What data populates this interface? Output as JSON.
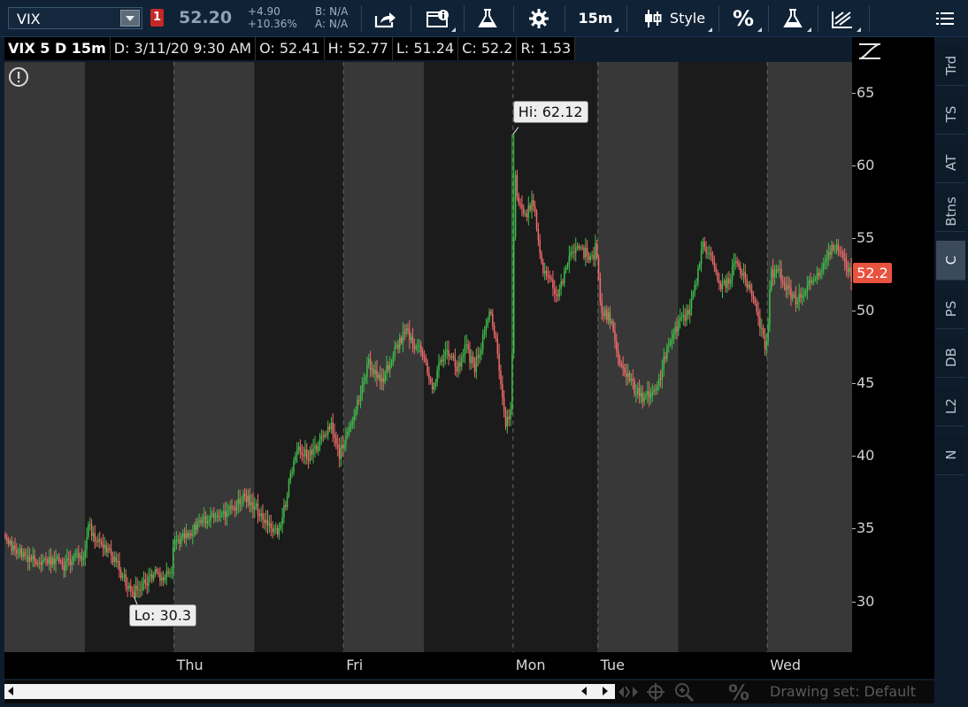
{
  "toolbar": {
    "symbol": "VIX",
    "alert_badge": "1",
    "last_price": "52.20",
    "change_abs": "+4.90",
    "change_pct": "+10.36%",
    "bid": "B: N/A",
    "ask": "A: N/A",
    "timeframe_label": "15m",
    "style_label": "Style",
    "percent_label": "%"
  },
  "info_bar": {
    "title": "VIX 5 D 15m",
    "date": "D: 3/11/20 9:30 AM",
    "open": "O: 52.41",
    "high": "H: 52.77",
    "low": "L: 51.24",
    "close": "C: 52.2",
    "range": "R: 1.53"
  },
  "side_tabs": [
    "Trd",
    "TS",
    "AT",
    "Btns",
    "C",
    "PS",
    "DB",
    "L2",
    "N"
  ],
  "active_side_tab": "C",
  "drawing_set": "Drawing set: Default",
  "colors": {
    "up": "#3fbf4a",
    "down": "#f26b6b",
    "session_light": "#383838",
    "session_dark": "#1b1b1b",
    "last_price_box": "#e8533f"
  },
  "chart_data": {
    "type": "candlestick",
    "symbol": "VIX",
    "ylim": [
      26.5,
      67.1
    ],
    "yticks": [
      30,
      35,
      40,
      45,
      50,
      55,
      60,
      65
    ],
    "xlim": [
      0,
      1
    ],
    "day_labels": [
      {
        "label": "Thu",
        "x": 0.2
      },
      {
        "label": "Fri",
        "x": 0.4
      },
      {
        "label": "Mon",
        "x": 0.6
      },
      {
        "label": "Tue",
        "x": 0.7
      },
      {
        "label": "Wed",
        "x": 0.9
      }
    ],
    "annotations": {
      "high": {
        "label": "Hi: 62.12",
        "value": 62.12,
        "x": 0.6
      },
      "low": {
        "label": "Lo: 30.3",
        "value": 30.3,
        "x": 0.153
      }
    },
    "last_value": "52.2",
    "path": [
      [
        0.0,
        34.6
      ],
      [
        0.01,
        33.8
      ],
      [
        0.02,
        33.2
      ],
      [
        0.035,
        32.8
      ],
      [
        0.05,
        32.7
      ],
      [
        0.06,
        32.9
      ],
      [
        0.07,
        32.3
      ],
      [
        0.08,
        32.9
      ],
      [
        0.095,
        33.2
      ],
      [
        0.1,
        35.3
      ],
      [
        0.11,
        34.2
      ],
      [
        0.125,
        33.5
      ],
      [
        0.135,
        32.4
      ],
      [
        0.145,
        31.1
      ],
      [
        0.153,
        30.5
      ],
      [
        0.165,
        31.3
      ],
      [
        0.18,
        31.9
      ],
      [
        0.19,
        31.6
      ],
      [
        0.199,
        31.9
      ],
      [
        0.2,
        33.8
      ],
      [
        0.215,
        34.6
      ],
      [
        0.23,
        35.3
      ],
      [
        0.25,
        36.0
      ],
      [
        0.27,
        36.2
      ],
      [
        0.285,
        37.2
      ],
      [
        0.295,
        36.5
      ],
      [
        0.305,
        36.0
      ],
      [
        0.315,
        35.0
      ],
      [
        0.325,
        34.8
      ],
      [
        0.335,
        37.5
      ],
      [
        0.345,
        40.5
      ],
      [
        0.36,
        40.0
      ],
      [
        0.375,
        41.0
      ],
      [
        0.385,
        42.3
      ],
      [
        0.395,
        40.0
      ],
      [
        0.405,
        41.5
      ],
      [
        0.415,
        43.0
      ],
      [
        0.43,
        46.5
      ],
      [
        0.445,
        45.0
      ],
      [
        0.46,
        47.0
      ],
      [
        0.475,
        48.5
      ],
      [
        0.485,
        47.5
      ],
      [
        0.495,
        47.0
      ],
      [
        0.505,
        44.5
      ],
      [
        0.515,
        46.5
      ],
      [
        0.525,
        47.0
      ],
      [
        0.535,
        46.0
      ],
      [
        0.545,
        47.5
      ],
      [
        0.555,
        46.0
      ],
      [
        0.565,
        48.0
      ],
      [
        0.575,
        50.0
      ],
      [
        0.585,
        46.0
      ],
      [
        0.592,
        42.0
      ],
      [
        0.599,
        43.0
      ],
      [
        0.603,
        59.5
      ],
      [
        0.607,
        57.5
      ],
      [
        0.615,
        56.5
      ],
      [
        0.625,
        57.5
      ],
      [
        0.635,
        53.0
      ],
      [
        0.645,
        52.0
      ],
      [
        0.655,
        51.0
      ],
      [
        0.665,
        53.5
      ],
      [
        0.675,
        54.5
      ],
      [
        0.685,
        54.0
      ],
      [
        0.695,
        53.5
      ],
      [
        0.699,
        54.5
      ],
      [
        0.705,
        50.0
      ],
      [
        0.715,
        49.5
      ],
      [
        0.725,
        47.0
      ],
      [
        0.735,
        45.5
      ],
      [
        0.745,
        44.5
      ],
      [
        0.755,
        44.0
      ],
      [
        0.765,
        44.5
      ],
      [
        0.775,
        45.5
      ],
      [
        0.785,
        48.0
      ],
      [
        0.795,
        49.0
      ],
      [
        0.805,
        49.5
      ],
      [
        0.815,
        51.5
      ],
      [
        0.825,
        54.5
      ],
      [
        0.835,
        54.0
      ],
      [
        0.845,
        51.5
      ],
      [
        0.855,
        52.0
      ],
      [
        0.865,
        53.5
      ],
      [
        0.875,
        52.0
      ],
      [
        0.885,
        50.5
      ],
      [
        0.895,
        48.5
      ],
      [
        0.899,
        46.5
      ],
      [
        0.905,
        52.5
      ],
      [
        0.915,
        52.5
      ],
      [
        0.925,
        51.5
      ],
      [
        0.935,
        50.5
      ],
      [
        0.945,
        51.5
      ],
      [
        0.96,
        52.5
      ],
      [
        0.97,
        53.5
      ],
      [
        0.98,
        54.5
      ],
      [
        0.99,
        54.0
      ],
      [
        1.0,
        52.2
      ]
    ]
  }
}
